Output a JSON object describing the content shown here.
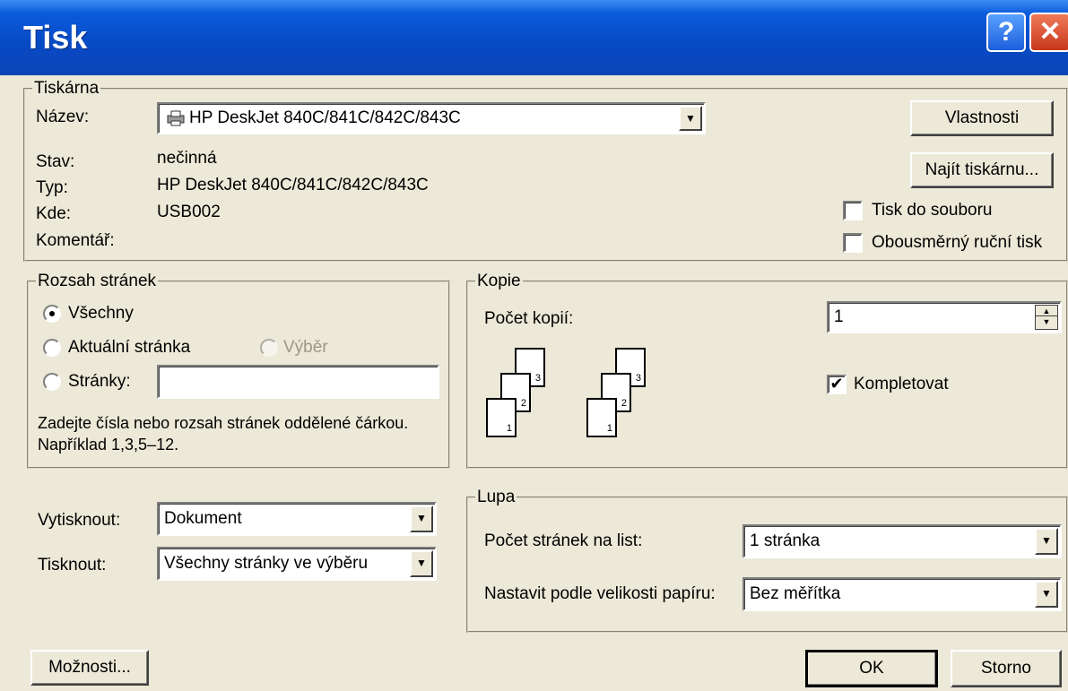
{
  "window": {
    "title": "Tisk",
    "help_glyph": "?",
    "close_glyph": "✕"
  },
  "printer": {
    "legend": "Tiskárna",
    "name_label": "Název:",
    "name_value": "HP DeskJet 840C/841C/842C/843C",
    "status_label": "Stav:",
    "status_value": "nečinná",
    "type_label": "Typ:",
    "type_value": "HP DeskJet 840C/841C/842C/843C",
    "where_label": "Kde:",
    "where_value": "USB002",
    "comment_label": "Komentář:",
    "properties_button": "Vlastnosti",
    "find_button": "Najít tiskárnu...",
    "print_to_file_label": "Tisk do souboru",
    "print_to_file_checked": false,
    "duplex_label": "Obousměrný ruční tisk",
    "duplex_checked": false
  },
  "range": {
    "legend": "Rozsah stránek",
    "all_label": "Všechny",
    "current_label": "Aktuální stránka",
    "selection_label": "Výběr",
    "pages_label": "Stránky:",
    "pages_value": "",
    "selected": "all",
    "hint": "Zadejte čísla nebo rozsah stránek oddělené čárkou. Například 1,3,5–12."
  },
  "copies": {
    "legend": "Kopie",
    "count_label": "Počet kopií:",
    "count_value": "1",
    "collate_label": "Kompletovat",
    "collate_checked": true,
    "page_numbers": [
      "3",
      "2",
      "1"
    ]
  },
  "print_what": {
    "label": "Vytisknout:",
    "value": "Dokument",
    "print_label": "Tisknout:",
    "print_value": "Všechny stránky ve výběru"
  },
  "zoom": {
    "legend": "Lupa",
    "pages_per_sheet_label": "Počet stránek na list:",
    "pages_per_sheet_value": "1 stránka",
    "scale_label": "Nastavit podle velikosti papíru:",
    "scale_value": "Bez měřítka"
  },
  "buttons": {
    "options": "Možnosti...",
    "ok": "OK",
    "cancel": "Storno"
  },
  "colors": {
    "title_bar": "#0849c4",
    "dialog_bg": "#ece9d8"
  }
}
